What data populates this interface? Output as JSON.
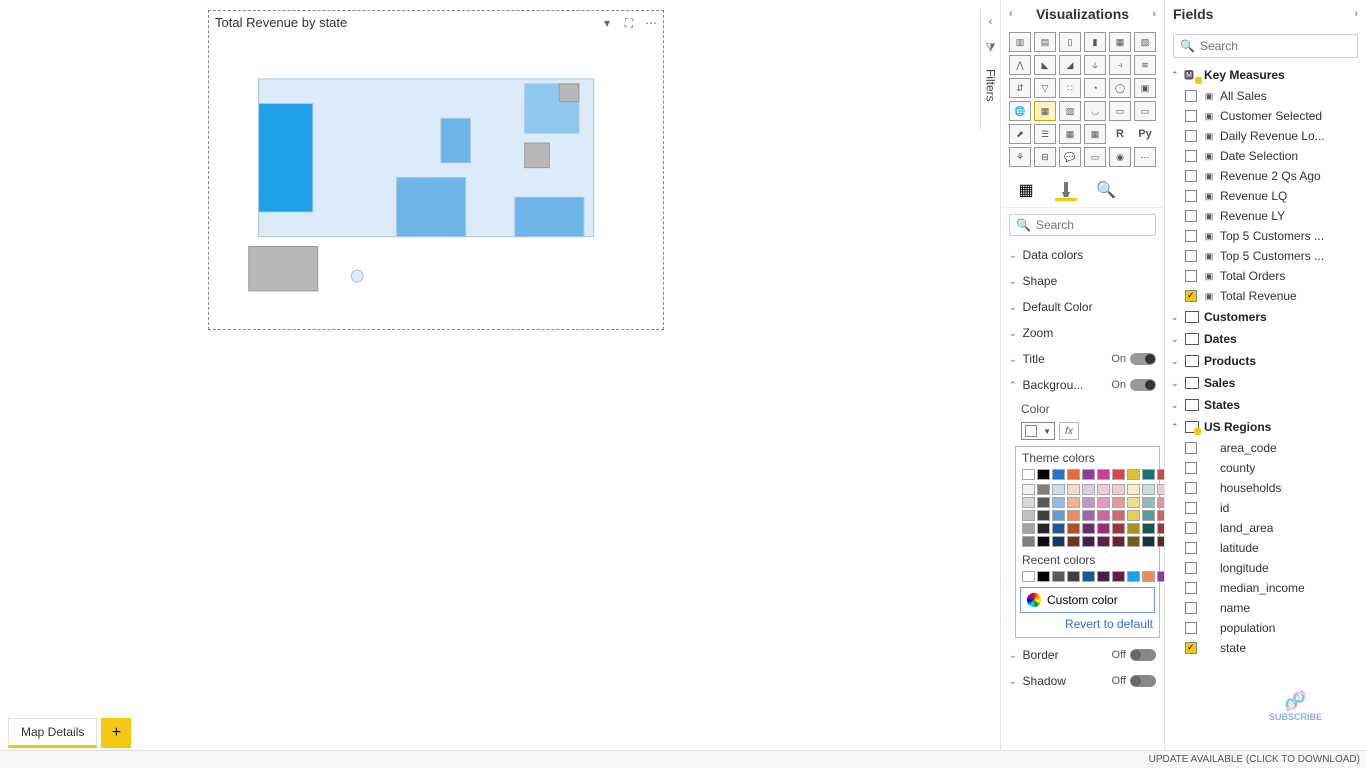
{
  "canvas": {
    "visual_title": "Total Revenue by state"
  },
  "tabs": {
    "page1": "Map Details"
  },
  "filters_pane": {
    "label": "Filters"
  },
  "viz_pane": {
    "title": "Visualizations",
    "search_placeholder": "Search",
    "format_sections": {
      "data_colors": "Data colors",
      "shape": "Shape",
      "default_color": "Default Color",
      "zoom": "Zoom",
      "title": {
        "label": "Title",
        "state": "On"
      },
      "background": {
        "label": "Backgrou...",
        "state": "On",
        "color_label": "Color"
      },
      "border": {
        "label": "Border",
        "state": "Off"
      },
      "shadow": {
        "label": "Shadow",
        "state": "Off"
      }
    },
    "color_picker": {
      "theme_label": "Theme colors",
      "recent_label": "Recent colors",
      "custom_label": "Custom color",
      "revert_label": "Revert to default",
      "theme_row0": [
        "#ffffff",
        "#000000",
        "#1f77d4",
        "#e66c37",
        "#8b3c9e",
        "#c83d95",
        "#d64550",
        "#e0c132",
        "#197278",
        "#c0504d"
      ],
      "theme_shades": [
        [
          "#f2f2f2",
          "#7f7f7f",
          "#c7dff4",
          "#f8d9c7",
          "#e1cae6",
          "#f0cbe0",
          "#f3cbcd",
          "#f7eec7",
          "#c7dedd",
          "#efcbc9"
        ],
        [
          "#d8d8d8",
          "#595959",
          "#8fbfe9",
          "#f1b38f",
          "#c395cc",
          "#e197c1",
          "#e7979b",
          "#efdd8f",
          "#8fbdbb",
          "#df9793"
        ],
        [
          "#bfbfbf",
          "#3f3f3f",
          "#579fdf",
          "#ea8d57",
          "#a560b3",
          "#d263a2",
          "#db6369",
          "#e7cc57",
          "#579c99",
          "#cf635d"
        ],
        [
          "#a5a5a5",
          "#262626",
          "#17599f",
          "#ac5129",
          "#682d76",
          "#962e70",
          "#a0343c",
          "#a89125",
          "#13565a",
          "#903c39"
        ],
        [
          "#7f7f7f",
          "#0c0c0c",
          "#0f3b6a",
          "#73361c",
          "#451e4f",
          "#641e4b",
          "#6b2228",
          "#705f19",
          "#0d393c",
          "#602826"
        ]
      ],
      "recent": [
        "#ffffff",
        "#000000",
        "#595959",
        "#3f3f3f",
        "#17599f",
        "#451e4f",
        "#641e4b",
        "#1f9fe6",
        "#ea8d57",
        "#8b3c9e"
      ]
    }
  },
  "fields_pane": {
    "title": "Fields",
    "search_placeholder": "Search",
    "tables": [
      {
        "name": "Key Measures",
        "type": "measure",
        "expanded": true,
        "badge": true,
        "fields": [
          {
            "name": "All Sales",
            "checked": false,
            "icon": "m"
          },
          {
            "name": "Customer Selected",
            "checked": false,
            "icon": "m"
          },
          {
            "name": "Daily Revenue Lo...",
            "checked": false,
            "icon": "m"
          },
          {
            "name": "Date Selection",
            "checked": false,
            "icon": "m"
          },
          {
            "name": "Revenue 2 Qs Ago",
            "checked": false,
            "icon": "m"
          },
          {
            "name": "Revenue LQ",
            "checked": false,
            "icon": "m"
          },
          {
            "name": "Revenue LY",
            "checked": false,
            "icon": "m"
          },
          {
            "name": "Top 5 Customers ...",
            "checked": false,
            "icon": "m"
          },
          {
            "name": "Top 5 Customers ...",
            "checked": false,
            "icon": "m"
          },
          {
            "name": "Total Orders",
            "checked": false,
            "icon": "m"
          },
          {
            "name": "Total Revenue",
            "checked": true,
            "icon": "m"
          }
        ]
      },
      {
        "name": "Customers",
        "type": "table",
        "expanded": false
      },
      {
        "name": "Dates",
        "type": "table",
        "expanded": false
      },
      {
        "name": "Products",
        "type": "table",
        "expanded": false
      },
      {
        "name": "Sales",
        "type": "table",
        "expanded": false
      },
      {
        "name": "States",
        "type": "table",
        "expanded": false
      },
      {
        "name": "US Regions",
        "type": "table",
        "expanded": true,
        "badge": true,
        "fields": [
          {
            "name": "area_code",
            "checked": false,
            "icon": ""
          },
          {
            "name": "county",
            "checked": false,
            "icon": ""
          },
          {
            "name": "households",
            "checked": false,
            "icon": ""
          },
          {
            "name": "id",
            "checked": false,
            "icon": ""
          },
          {
            "name": "land_area",
            "checked": false,
            "icon": ""
          },
          {
            "name": "latitude",
            "checked": false,
            "icon": ""
          },
          {
            "name": "longitude",
            "checked": false,
            "icon": ""
          },
          {
            "name": "median_income",
            "checked": false,
            "icon": ""
          },
          {
            "name": "name",
            "checked": false,
            "icon": ""
          },
          {
            "name": "population",
            "checked": false,
            "icon": ""
          },
          {
            "name": "state",
            "checked": true,
            "icon": ""
          }
        ]
      }
    ]
  },
  "status": {
    "update": "UPDATE AVAILABLE (CLICK TO DOWNLOAD)"
  },
  "subscribe": {
    "label": "SUBSCRIBE"
  }
}
